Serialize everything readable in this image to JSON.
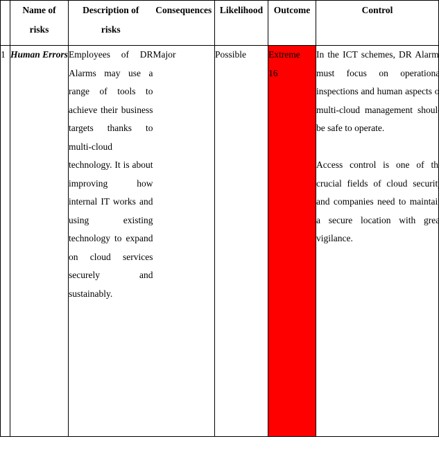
{
  "document": {
    "type": "risk-assessment-table",
    "colors": {
      "outcome_cell_background": "#ff0000",
      "text": "#000000",
      "border": "#000000",
      "page_background": "#ffffff"
    }
  },
  "table": {
    "headers": {
      "number": "",
      "name_of_risks": "Name of\nrisks",
      "name_of_risks_line1": "Name of",
      "name_of_risks_line2": "risks",
      "description_of_risks_line1": "Description of",
      "description_of_risks_line2": "risks",
      "consequences": "Consequences",
      "likelihood": "Likelihood",
      "outcome": "Outcome",
      "control": "Control"
    },
    "rows": [
      {
        "number": "1",
        "name_of_risks": "Human Errors",
        "description_of_risks": "Employees of DR Alarms may use a range of tools to achieve their business targets thanks to multi-cloud technology. It is about improving how internal IT works and using existing technology to expand on cloud services securely and sustainably.",
        "consequences": "Major",
        "likelihood": "Possible",
        "outcome_label": "Extreme",
        "outcome_score": "16",
        "control_paragraph_1": "In the ICT schemes, DR Alarms must focus on operational inspections and human aspects of multi-cloud management should be safe to operate.",
        "control_paragraph_2": "Access control is one of the crucial fields of cloud security and companies need to maintain a secure location with great vigilance."
      }
    ]
  }
}
